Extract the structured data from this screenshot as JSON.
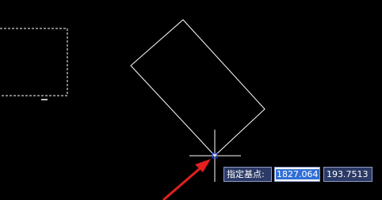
{
  "dynamic_input": {
    "prompt": "指定基点:",
    "x_value": "1827.064",
    "y_value": "193.7513"
  },
  "colors": {
    "canvas_background": "#000000",
    "geometry_stroke": "#ffffff",
    "prompt_background": "#2b3a66",
    "selection_highlight": "#2f6fd6",
    "annotation_arrow": "#e3201f",
    "crosshair_pickbox": "#2a4dff"
  }
}
